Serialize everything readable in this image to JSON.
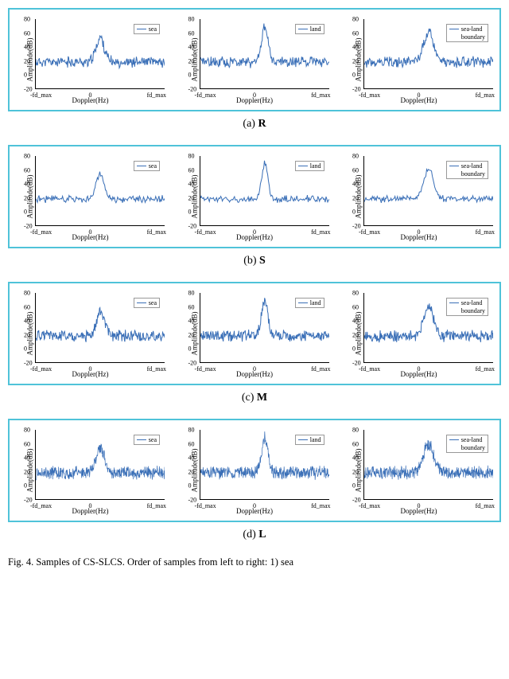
{
  "figure": {
    "panels": [
      {
        "letter": "R",
        "subplots": [
          {
            "legend": [
              "sea"
            ],
            "xlabel": "Doppler(Hz)",
            "ylabel": "Amplitude(dB)"
          },
          {
            "legend": [
              "land"
            ],
            "xlabel": "Doppler(Hz)",
            "ylabel": "Amplitude(dB)"
          },
          {
            "legend": [
              "sea-land",
              "boundary"
            ],
            "xlabel": "Doppler(Hz)",
            "ylabel": "Amplitude(dB)"
          }
        ]
      },
      {
        "letter": "S",
        "subplots": [
          {
            "legend": [
              "sea"
            ],
            "xlabel": "Doppler(Hz)",
            "ylabel": "Amplitude(dB)"
          },
          {
            "legend": [
              "land"
            ],
            "xlabel": "Doppler(Hz)",
            "ylabel": "Amplitude(dB)"
          },
          {
            "legend": [
              "sea-land",
              "boundary"
            ],
            "xlabel": "Doppler(Hz)",
            "ylabel": "Amplitude(dB)"
          }
        ]
      },
      {
        "letter": "M",
        "subplots": [
          {
            "legend": [
              "sea"
            ],
            "xlabel": "Doppler(Hz)",
            "ylabel": "Amplitude(dB)"
          },
          {
            "legend": [
              "land"
            ],
            "xlabel": "Doppler(Hz)",
            "ylabel": "Amplitude(dB)"
          },
          {
            "legend": [
              "sea-land",
              "boundary"
            ],
            "xlabel": "Doppler(Hz)",
            "ylabel": "Amplitude(dB)"
          }
        ]
      },
      {
        "letter": "L",
        "subplots": [
          {
            "legend": [
              "sea"
            ],
            "xlabel": "Doppler(Hz)",
            "ylabel": "Amplitude(dB)"
          },
          {
            "legend": [
              "land"
            ],
            "xlabel": "Doppler(Hz)",
            "ylabel": "Amplitude(dB)"
          },
          {
            "legend": [
              "sea-land",
              "boundary"
            ],
            "xlabel": "Doppler(Hz)",
            "ylabel": "Amplitude(dB)"
          }
        ]
      }
    ],
    "y_ticks": [
      "-20",
      "0",
      "20",
      "40",
      "60",
      "80"
    ],
    "x_tick_left": "-fd_max",
    "x_tick_mid": "0",
    "x_tick_right": "fd_max",
    "subcaption_prefix_a": "(a) ",
    "subcaption_prefix_b": "(b) ",
    "subcaption_prefix_c": "(c) ",
    "subcaption_prefix_d": "(d) ",
    "caption_prefix": "Fig. 4.    Samples of CS-SLCS. Order of samples from left to right: 1) sea"
  },
  "chart_data": [
    {
      "panel": "R",
      "subplots": [
        {
          "type": "line",
          "title": "sea",
          "xlabel": "Doppler(Hz)",
          "ylabel": "Amplitude(dB)",
          "xlim": [
            "-fd_max",
            "fd_max"
          ],
          "ylim": [
            -20,
            80
          ],
          "series": [
            {
              "name": "sea",
              "description": "noisy Doppler spectrum, baseline ~15-20 dB, central peak ~50 dB at ~0 Hz"
            }
          ]
        },
        {
          "type": "line",
          "title": "land",
          "xlabel": "Doppler(Hz)",
          "ylabel": "Amplitude(dB)",
          "xlim": [
            "-fd_max",
            "fd_max"
          ],
          "ylim": [
            -20,
            80
          ],
          "series": [
            {
              "name": "land",
              "description": "noisy Doppler spectrum, baseline ~15-20 dB, sharp central peak ~60-65 dB at ~0 Hz"
            }
          ]
        },
        {
          "type": "line",
          "title": "sea-land boundary",
          "xlabel": "Doppler(Hz)",
          "ylabel": "Amplitude(dB)",
          "xlim": [
            "-fd_max",
            "fd_max"
          ],
          "ylim": [
            -20,
            80
          ],
          "series": [
            {
              "name": "sea-land boundary",
              "description": "noisy Doppler spectrum, baseline ~15-20 dB, broader central peak ~55 dB near 0 Hz"
            }
          ]
        }
      ]
    },
    {
      "panel": "S",
      "subplots": [
        {
          "type": "line",
          "title": "sea",
          "xlabel": "Doppler(Hz)",
          "ylabel": "Amplitude(dB)",
          "xlim": [
            "-fd_max",
            "fd_max"
          ],
          "ylim": [
            -20,
            80
          ],
          "series": [
            {
              "name": "sea",
              "description": "smoother spectrum, baseline ~10-15 dB, central peak ~60 dB at ~0 Hz"
            }
          ]
        },
        {
          "type": "line",
          "title": "land",
          "xlabel": "Doppler(Hz)",
          "ylabel": "Amplitude(dB)",
          "xlim": [
            "-fd_max",
            "fd_max"
          ],
          "ylim": [
            -20,
            80
          ],
          "series": [
            {
              "name": "land",
              "description": "spectrum baseline ~10-15 dB, tall central peak ~70-75 dB at ~0 Hz"
            }
          ]
        },
        {
          "type": "line",
          "title": "sea-land boundary",
          "xlabel": "Doppler(Hz)",
          "ylabel": "Amplitude(dB)",
          "xlim": [
            "-fd_max",
            "fd_max"
          ],
          "ylim": [
            -20,
            80
          ],
          "series": [
            {
              "name": "sea-land boundary",
              "description": "spectrum baseline ~10-15 dB, central peak ~60 dB at ~0 Hz"
            }
          ]
        }
      ]
    },
    {
      "panel": "M",
      "subplots": [
        {
          "type": "line",
          "title": "sea",
          "xlabel": "Doppler(Hz)",
          "ylabel": "Amplitude(dB)",
          "xlim": [
            "-fd_max",
            "fd_max"
          ],
          "ylim": [
            -20,
            80
          ],
          "series": [
            {
              "name": "sea",
              "description": "noisy spectrum, baseline ~15-20 dB, central peak ~45-50 dB at ~0 Hz"
            }
          ]
        },
        {
          "type": "line",
          "title": "land",
          "xlabel": "Doppler(Hz)",
          "ylabel": "Amplitude(dB)",
          "xlim": [
            "-fd_max",
            "fd_max"
          ],
          "ylim": [
            -20,
            80
          ],
          "series": [
            {
              "name": "land",
              "description": "noisy spectrum, baseline ~15-20 dB, central peak ~55-60 dB at ~0 Hz"
            }
          ]
        },
        {
          "type": "line",
          "title": "sea-land boundary",
          "xlabel": "Doppler(Hz)",
          "ylabel": "Amplitude(dB)",
          "xlim": [
            "-fd_max",
            "fd_max"
          ],
          "ylim": [
            -20,
            80
          ],
          "series": [
            {
              "name": "sea-land boundary",
              "description": "noisy spectrum, baseline ~15-20 dB, broad central peak ~55 dB at ~0 Hz"
            }
          ]
        }
      ]
    },
    {
      "panel": "L",
      "subplots": [
        {
          "type": "line",
          "title": "sea",
          "xlabel": "Doppler(Hz)",
          "ylabel": "Amplitude(dB)",
          "xlim": [
            "-fd_max",
            "fd_max"
          ],
          "ylim": [
            -20,
            80
          ],
          "series": [
            {
              "name": "sea",
              "description": "dense noisy spectrum, baseline ~15-20 dB, central peak ~55 dB at ~0 Hz"
            }
          ]
        },
        {
          "type": "line",
          "title": "land",
          "xlabel": "Doppler(Hz)",
          "ylabel": "Amplitude(dB)",
          "xlim": [
            "-fd_max",
            "fd_max"
          ],
          "ylim": [
            -20,
            80
          ],
          "series": [
            {
              "name": "land",
              "description": "dense noisy spectrum, baseline ~15-20 dB, tall central peak ~65-70 dB at ~0 Hz"
            }
          ]
        },
        {
          "type": "line",
          "title": "sea-land boundary",
          "xlabel": "Doppler(Hz)",
          "ylabel": "Amplitude(dB)",
          "xlim": [
            "-fd_max",
            "fd_max"
          ],
          "ylim": [
            -20,
            80
          ],
          "series": [
            {
              "name": "sea-land boundary",
              "description": "dense noisy spectrum, baseline ~15-20 dB, central peak ~55-60 dB at ~0 Hz"
            }
          ]
        }
      ]
    }
  ]
}
